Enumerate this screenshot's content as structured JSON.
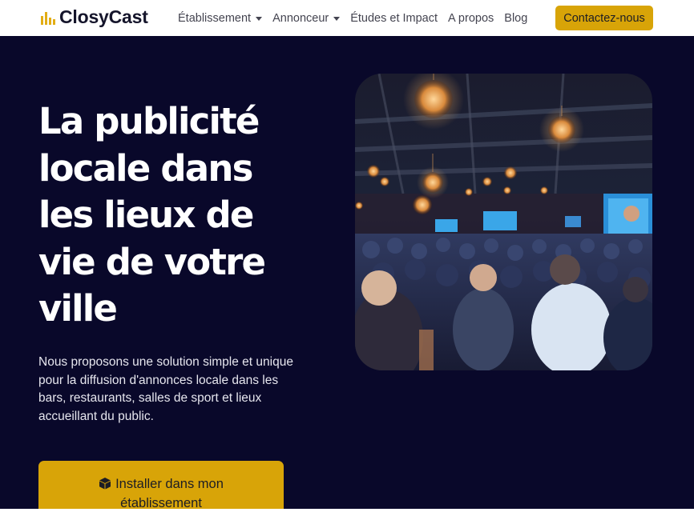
{
  "nav": {
    "brand_name": "ClosyCast",
    "brand_logo_icon": "bars-logo-icon",
    "items": [
      {
        "label": "Établissement",
        "has_dropdown": true
      },
      {
        "label": "Annonceur",
        "has_dropdown": true
      },
      {
        "label": "Études et Impact",
        "has_dropdown": false
      },
      {
        "label": "A propos",
        "has_dropdown": false
      },
      {
        "label": "Blog",
        "has_dropdown": false
      }
    ],
    "cta_label": "Contactez-nous"
  },
  "hero": {
    "title": "La publicité locale dans les lieux de vie de votre ville",
    "description": "Nous proposons une solution simple et unique pour la diffusion d'annonces locale dans les bars, restaurants, salles de sport et lieux accueillant du public.",
    "cta": {
      "icon": "box-icon",
      "line1": "Installer dans mon",
      "line2": "établissement"
    },
    "image_subject": "crowded bar with screens and hanging lights"
  },
  "colors": {
    "accent": "#d8a408",
    "hero_background": "#09082a",
    "brand_text": "#15152b"
  }
}
